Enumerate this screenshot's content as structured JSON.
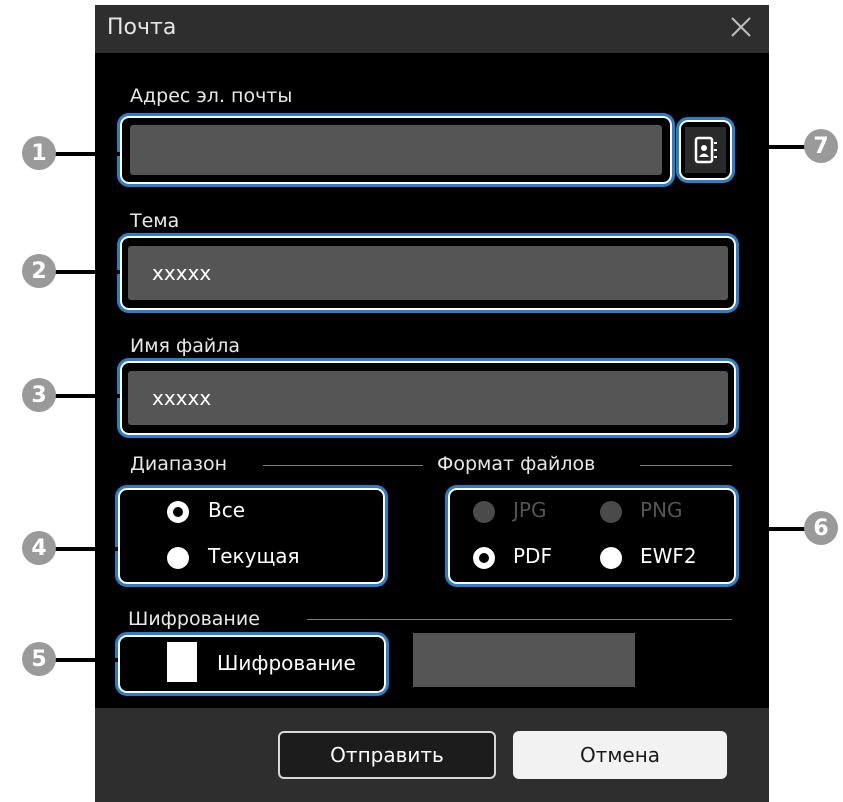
{
  "dialog": {
    "title": "Почта",
    "close_icon": "close-icon"
  },
  "fields": {
    "email_label": "Адрес эл. почты",
    "email_value": "",
    "subject_label": "Тема",
    "subject_value": "xxxxx",
    "filename_label": "Имя файла",
    "filename_value": "xxxxx",
    "address_book_icon": "address-book-icon"
  },
  "range": {
    "label": "Диапазон",
    "options": [
      "Все",
      "Текущая"
    ],
    "selected": "Все"
  },
  "format": {
    "label": "Формат файлов",
    "options": [
      "JPG",
      "PNG",
      "PDF",
      "EWF2"
    ],
    "disabled": [
      "JPG",
      "PNG"
    ],
    "selected": "PDF"
  },
  "encryption": {
    "label": "Шифрование",
    "checkbox_label": "Шифрование",
    "checked": false,
    "password_value": ""
  },
  "buttons": {
    "send": "Отправить",
    "cancel": "Отмена"
  },
  "callouts": [
    "1",
    "2",
    "3",
    "4",
    "5",
    "6",
    "7"
  ],
  "colors": {
    "highlight": "#2b7fc9",
    "callout": "#9a9a9a",
    "dialog_bg": "#000000",
    "field_bg": "#555555"
  }
}
